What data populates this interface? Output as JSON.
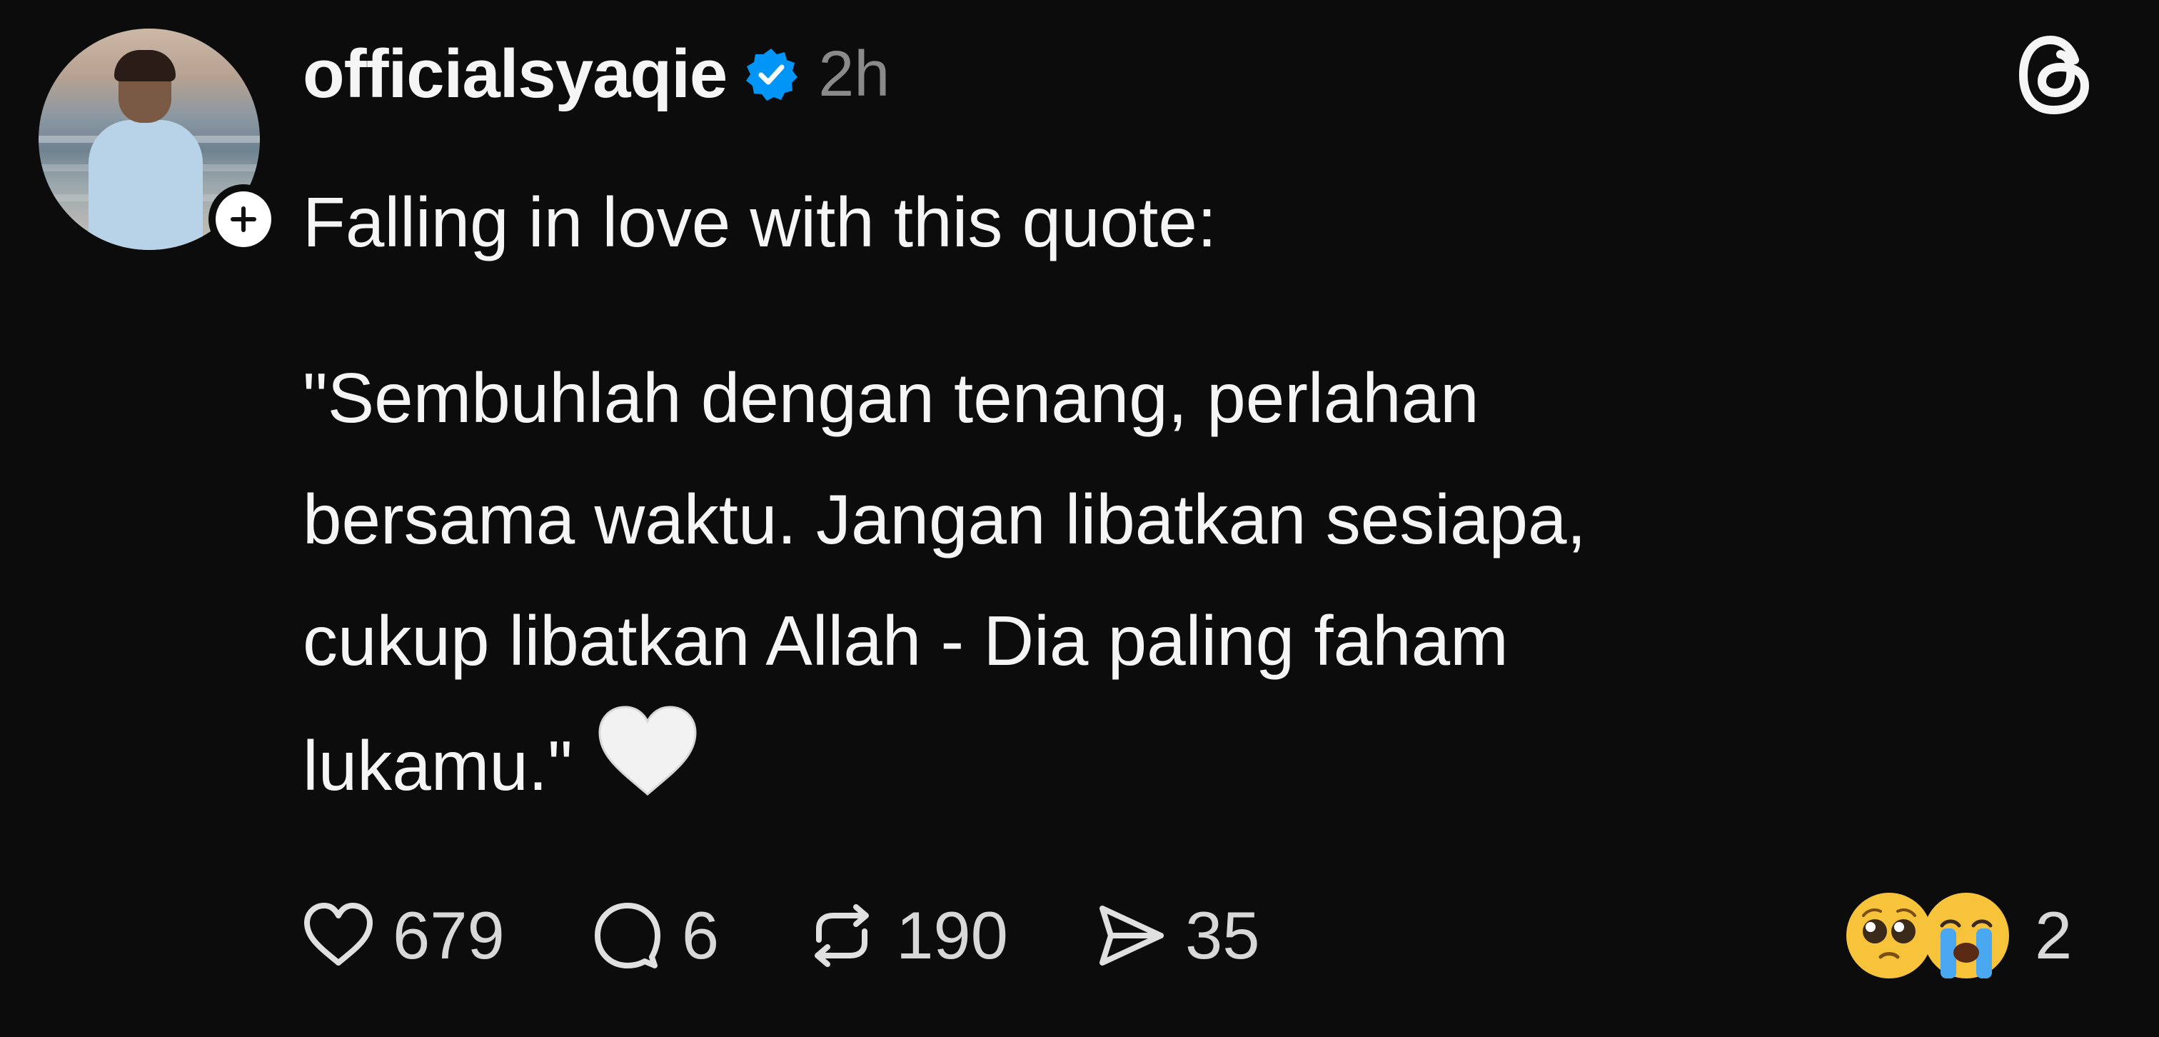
{
  "post": {
    "username": "officialsyaqie",
    "time": "2h",
    "intro": "Falling in love with this quote:",
    "quote_lines": [
      "\"Sembuhlah dengan tenang, perlahan",
      "bersama waktu. Jangan libatkan sesiapa,",
      "cukup libatkan Allah - Dia paling faham",
      "lukamu.\""
    ],
    "trailing_emoji": "white-heart-emoji"
  },
  "actions": {
    "likes": "679",
    "replies": "6",
    "reposts": "190",
    "shares": "35"
  },
  "reactions": {
    "emojis": [
      "pleading-face-emoji",
      "loudly-crying-face-emoji"
    ],
    "count": "2"
  },
  "icons": {
    "verified": "verified-badge-icon",
    "follow": "plus-icon",
    "app": "threads-logo-icon"
  },
  "colors": {
    "background": "#0c0c0c",
    "text": "#f5f5f5",
    "muted": "#8a8a8a",
    "verified": "#0095f6"
  }
}
